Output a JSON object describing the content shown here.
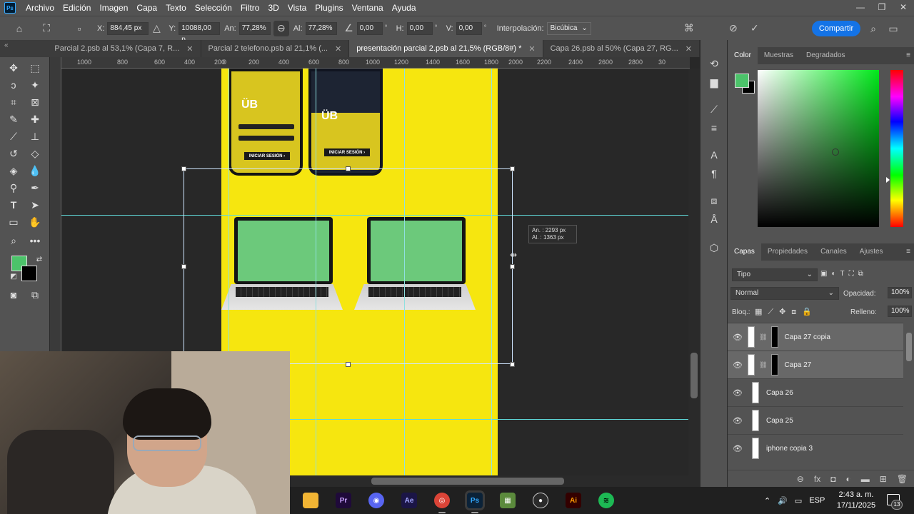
{
  "menubar": {
    "logo": "Ps",
    "items": [
      "Archivo",
      "Edición",
      "Imagen",
      "Capa",
      "Texto",
      "Selección",
      "Filtro",
      "3D",
      "Vista",
      "Plugins",
      "Ventana",
      "Ayuda"
    ]
  },
  "options": {
    "x_label": "X:",
    "x_value": "884,45 px",
    "y_label": "Y:",
    "y_value": "10088,00 p",
    "w_label": "An:",
    "w_value": "77,28%",
    "h_label": "Al:",
    "h_value": "77,28%",
    "angle_value": "0,00",
    "angle_unit": "°",
    "hskew_label": "H:",
    "hskew_value": "0,00",
    "hskew_unit": "°",
    "vskew_label": "V:",
    "vskew_value": "0,00",
    "vskew_unit": "°",
    "interp_label": "Interpolación:",
    "interp_value": "Bicúbica",
    "share_label": "Compartir"
  },
  "tabs": [
    {
      "label": "Parcial 2.psb al 53,1% (Capa 7, R...",
      "active": false
    },
    {
      "label": "Parcial 2 telefono.psb al 21,1% (...",
      "active": false
    },
    {
      "label": "presentación parcial 2.psb al 21,5% (RGB/8#) *",
      "active": true
    },
    {
      "label": "Capa 26.psb al 50% (Capa 27, RG...",
      "active": false
    }
  ],
  "ruler_top": [
    "1000",
    "800",
    "600",
    "400",
    "200",
    "0",
    "200",
    "400",
    "600",
    "800",
    "1000",
    "1200",
    "1400",
    "1600",
    "1800",
    "2000",
    "2200",
    "2400",
    "2600",
    "2800",
    "30"
  ],
  "canvas": {
    "phone_button": "INICIAR SESIÓN  ›",
    "phone_logo": "ÜB",
    "dims_w": "An. :  2293 px",
    "dims_h": "Al. :  1363 px"
  },
  "color_panel": {
    "tabs": [
      "Color",
      "Muestras",
      "Degradados"
    ],
    "foreground": "#4cc36a",
    "background": "#000000"
  },
  "layers_panel": {
    "tabs": [
      "Capas",
      "Propiedades",
      "Canales",
      "Ajustes"
    ],
    "filter": "Tipo",
    "blend_mode": "Normal",
    "opacity_label": "Opacidad:",
    "opacity_value": "100%",
    "lock_label": "Bloq.:",
    "fill_label": "Relleno:",
    "fill_value": "100%",
    "layers": [
      {
        "name": "Capa 27 copia",
        "selected": true,
        "masked": true
      },
      {
        "name": "Capa 27",
        "selected": true,
        "masked": true
      },
      {
        "name": "Capa 26",
        "selected": false,
        "masked": false
      },
      {
        "name": "Capa 25",
        "selected": false,
        "masked": false
      },
      {
        "name": "iphone copia 3",
        "selected": false,
        "masked": false
      }
    ]
  },
  "taskbar": {
    "apps": [
      "file-explorer",
      "premiere",
      "discord",
      "after-effects",
      "chrome",
      "photoshop",
      "minecraft",
      "obs",
      "illustrator",
      "spotify"
    ],
    "language": "ESP",
    "time": "2:43 a. m.",
    "date": "17/11/2025",
    "notifications": "13"
  }
}
